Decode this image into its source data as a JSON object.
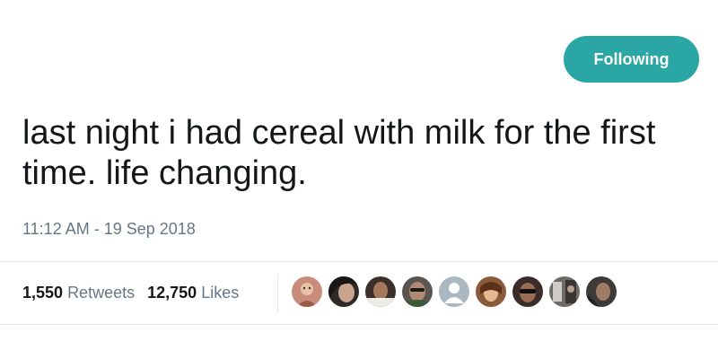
{
  "follow_button": {
    "label": "Following"
  },
  "tweet": {
    "text": "last night i had cereal with milk for the first time. life changing.",
    "timestamp": "11:12 AM - 19 Sep 2018"
  },
  "stats": {
    "retweets_count": "1,550",
    "retweets_label": "Retweets",
    "likes_count": "12,750",
    "likes_label": "Likes"
  },
  "liked_by_avatars": [
    {
      "name": "avatar-1",
      "color": "#c98c7a"
    },
    {
      "name": "avatar-2",
      "color": "#2f2a28"
    },
    {
      "name": "avatar-3",
      "color": "#3b2f2a"
    },
    {
      "name": "avatar-4",
      "color": "#5b5450"
    },
    {
      "name": "avatar-5-default",
      "color": "#aab8c2"
    },
    {
      "name": "avatar-6",
      "color": "#8a5a3a"
    },
    {
      "name": "avatar-7",
      "color": "#3a2c28"
    },
    {
      "name": "avatar-8",
      "color": "#6e6a68"
    },
    {
      "name": "avatar-9",
      "color": "#3e3a38"
    }
  ],
  "colors": {
    "accent": "#2aa6a4",
    "text": "#14171a",
    "secondary_text": "#657786",
    "divider": "#e1e8ed"
  }
}
